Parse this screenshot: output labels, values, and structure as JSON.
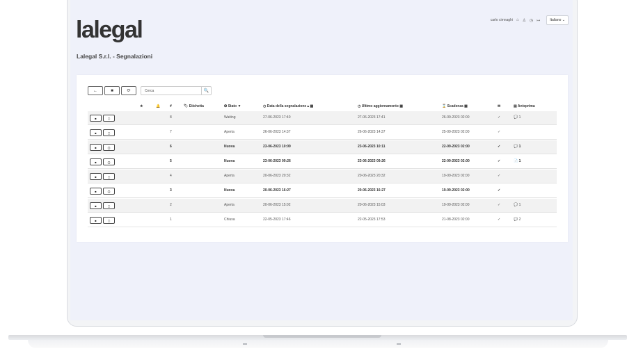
{
  "app": {
    "logo": "lalegal",
    "subtitle": "Lalegal S.r.l. - Segnalazioni",
    "user": "carlo cimnaghi",
    "language": "Italiano",
    "accent": "#333333",
    "background": "#eff1fa"
  },
  "toolbar": {
    "back_icon": "←",
    "stop_icon": "■",
    "refresh_icon": "⟳",
    "search_placeholder": "Cerca",
    "search_icon": "🔍"
  },
  "table": {
    "headers": {
      "star": "★",
      "bell": "🔔",
      "num": "#",
      "etichetta": "🏷 Etichetta",
      "stato": "✪ Stato ▼",
      "data": "◷ Data della segnalazione ▴ ▦",
      "ultimo": "◷ Ultimo aggiornamento ▦",
      "scadenza": "⌛ Scadenza ▦",
      "letto": "✉",
      "anteprima": "▤ Anteprima"
    },
    "row_btn_a": "■",
    "row_btn_b": "▢",
    "rows": [
      {
        "num": "8",
        "stato": "Waiting",
        "data": "27-06-2023 17:40",
        "ultimo": "27-06-2023 17:41",
        "scadenza": "26-09-2023 02:00",
        "check": "✓",
        "anteprima": "💬 1"
      },
      {
        "num": "7",
        "stato": "Aperta",
        "data": "26-06-2023 14:37",
        "ultimo": "26-06-2023 14:37",
        "scadenza": "25-09-2023 02:00",
        "check": "✓",
        "anteprima": ""
      },
      {
        "num": "6",
        "stato": "Nuova",
        "data": "23-06-2023 10:09",
        "ultimo": "23-06-2023 10:11",
        "scadenza": "22-09-2023 02:00",
        "check": "✓",
        "anteprima": "💬 1"
      },
      {
        "num": "5",
        "stato": "Nuova",
        "data": "23-06-2023 09:26",
        "ultimo": "23-06-2023 09:26",
        "scadenza": "22-09-2023 02:00",
        "check": "✓",
        "anteprima": "📄 1"
      },
      {
        "num": "4",
        "stato": "Aperta",
        "data": "20-06-2023 20:32",
        "ultimo": "20-06-2023 20:32",
        "scadenza": "19-09-2023 02:00",
        "check": "✓",
        "anteprima": ""
      },
      {
        "num": "3",
        "stato": "Nuova",
        "data": "20-06-2023 16:27",
        "ultimo": "20-06-2023 16:27",
        "scadenza": "19-09-2023 02:00",
        "check": "✓",
        "anteprima": ""
      },
      {
        "num": "2",
        "stato": "Aperta",
        "data": "20-06-2023 15:02",
        "ultimo": "20-06-2023 15:03",
        "scadenza": "19-09-2023 02:00",
        "check": "✓",
        "anteprima": "💬 1"
      },
      {
        "num": "1",
        "stato": "Chiusa",
        "data": "22-05-2023 17:46",
        "ultimo": "22-05-2023 17:53",
        "scadenza": "21-08-2023 02:00",
        "check": "✓",
        "anteprima": "💬 2"
      }
    ]
  }
}
